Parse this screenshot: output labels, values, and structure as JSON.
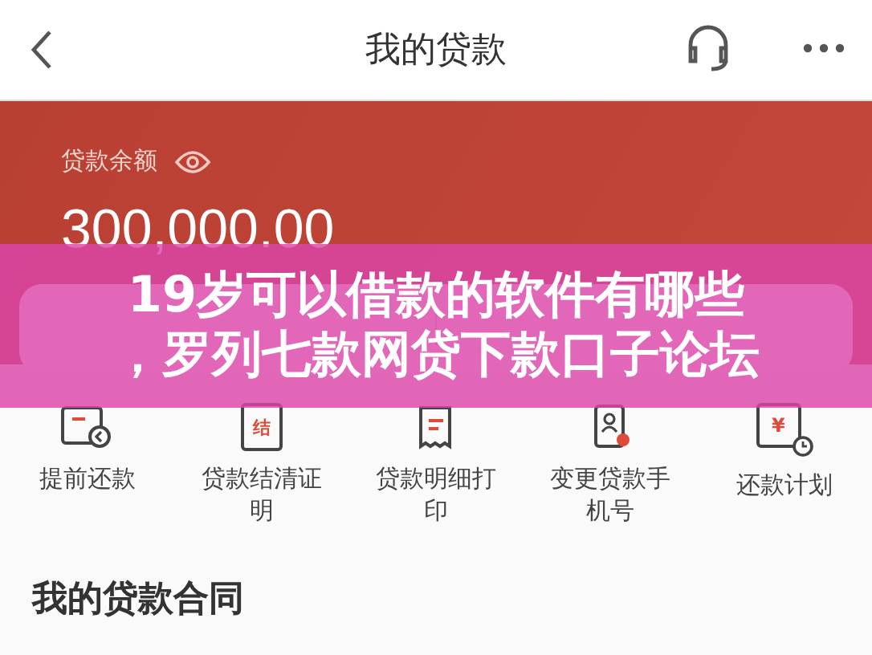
{
  "header": {
    "title": "我的贷款"
  },
  "balance": {
    "label": "贷款余额",
    "amount": "300,000.00"
  },
  "actions": [
    {
      "kind": "prepay",
      "label": "提前还款"
    },
    {
      "kind": "certificate",
      "label": "贷款结清证明",
      "icon_text": "结"
    },
    {
      "kind": "receipt",
      "label": "贷款明细打印"
    },
    {
      "kind": "phone",
      "label": "变更贷款手机号"
    },
    {
      "kind": "plan",
      "label": "还款计划",
      "icon_text": "¥"
    }
  ],
  "section_title": "我的贷款合同",
  "overlay": {
    "lines": [
      "19岁可以借款的软件有哪些",
      "，罗列七款网贷下款口子论坛"
    ]
  }
}
